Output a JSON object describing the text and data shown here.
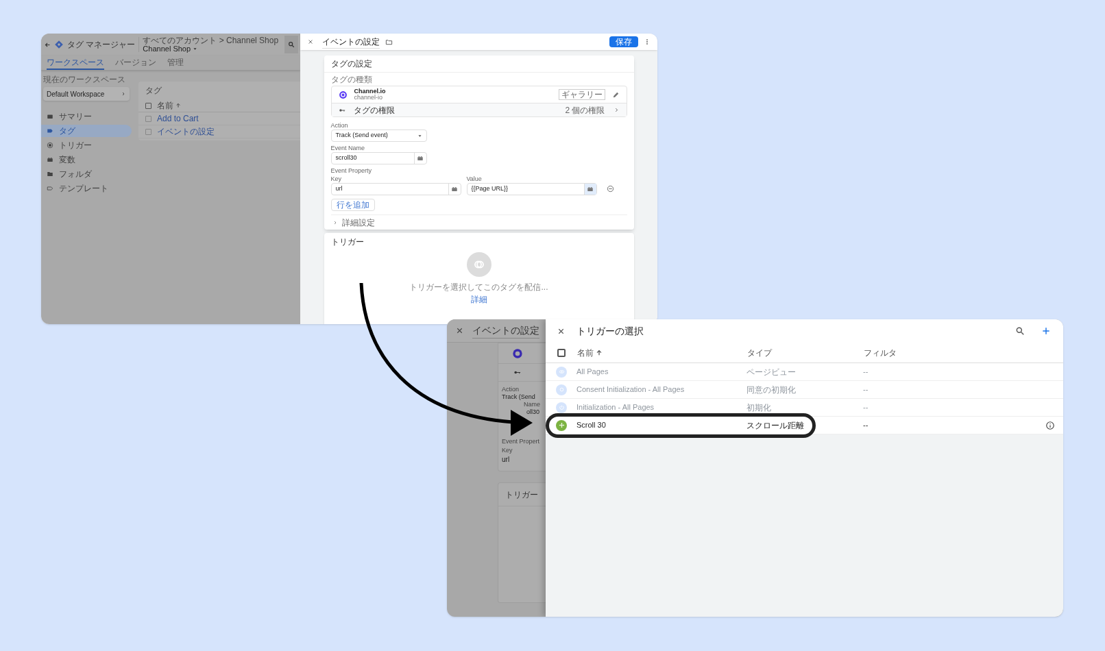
{
  "tag_manager_window": {
    "header": {
      "app_title": "タグ マネージャー",
      "breadcrumb": "すべてのアカウント > Channel Shop",
      "container_name": "Channel Shop"
    },
    "tabs": [
      {
        "label": "ワークスペース",
        "selected": true
      },
      {
        "label": "バージョン",
        "selected": false
      },
      {
        "label": "管理",
        "selected": false
      }
    ],
    "workspace": {
      "label": "現在のワークスペース",
      "name": "Default Workspace"
    },
    "nav": [
      {
        "label": "サマリー",
        "kind": "summary",
        "selected": false
      },
      {
        "label": "タグ",
        "kind": "tag",
        "selected": true
      },
      {
        "label": "トリガー",
        "kind": "trigger",
        "selected": false
      },
      {
        "label": "変数",
        "kind": "variable",
        "selected": false
      },
      {
        "label": "フォルダ",
        "kind": "folder",
        "selected": false
      },
      {
        "label": "テンプレート",
        "kind": "template",
        "selected": false
      }
    ],
    "tags_panel": {
      "title": "タグ",
      "column": "名前",
      "select_all_checked": false,
      "rows": [
        {
          "name": "Add to Cart",
          "checked": false
        },
        {
          "name": "イベントの設定",
          "checked": false
        }
      ]
    },
    "editor": {
      "title": "イベントの設定",
      "save_button": "保存",
      "config_card": {
        "title": "タグの設定",
        "type_label": "タグの種類",
        "tag_type": {
          "name": "Channel.io",
          "id": "channel-io",
          "badge": "ギャラリー"
        },
        "permissions": {
          "label": "タグの権限",
          "count": "2 個の権限"
        },
        "action": {
          "label": "Action",
          "value": "Track (Send event)"
        },
        "event_name": {
          "label": "Event Name",
          "value": "scroll30"
        },
        "event_property": {
          "label": "Event Property",
          "key_label": "Key",
          "value_label": "Value",
          "key": "url",
          "value": "{{Page URL}}"
        },
        "add_row_button": "行を追加",
        "advanced": {
          "label": "詳細設定",
          "expanded": false
        }
      },
      "trigger_card": {
        "title": "トリガー",
        "hint": "トリガーを選択してこのタグを配信...",
        "link": "詳細"
      }
    }
  },
  "trigger_window": {
    "editor_behind": {
      "title": "イベントの設定",
      "action_label": "Action",
      "action_value": "Track (Send",
      "event_name_label": "Name",
      "event_name_value": "oll30",
      "event_property_label": "Event Propert",
      "key_label": "Key",
      "key_value": "url",
      "trigger_title": "トリガー"
    },
    "dialog": {
      "title": "トリガーの選択",
      "columns": [
        "名前",
        "タイプ",
        "フィルタ"
      ],
      "select_all_checked": false,
      "rows": [
        {
          "name": "All Pages",
          "type": "ページビュー",
          "filter": "--",
          "kind": "pageview",
          "disabled": true,
          "highlighted": false
        },
        {
          "name": "Consent Initialization - All Pages",
          "type": "同意の初期化",
          "filter": "--",
          "kind": "consent",
          "disabled": true,
          "highlighted": false
        },
        {
          "name": "Initialization - All Pages",
          "type": "初期化",
          "filter": "--",
          "kind": "initialization",
          "disabled": true,
          "highlighted": false
        },
        {
          "name": "Scroll 30",
          "type": "スクロール距離",
          "filter": "--",
          "kind": "scroll",
          "disabled": false,
          "highlighted": true
        }
      ]
    }
  }
}
